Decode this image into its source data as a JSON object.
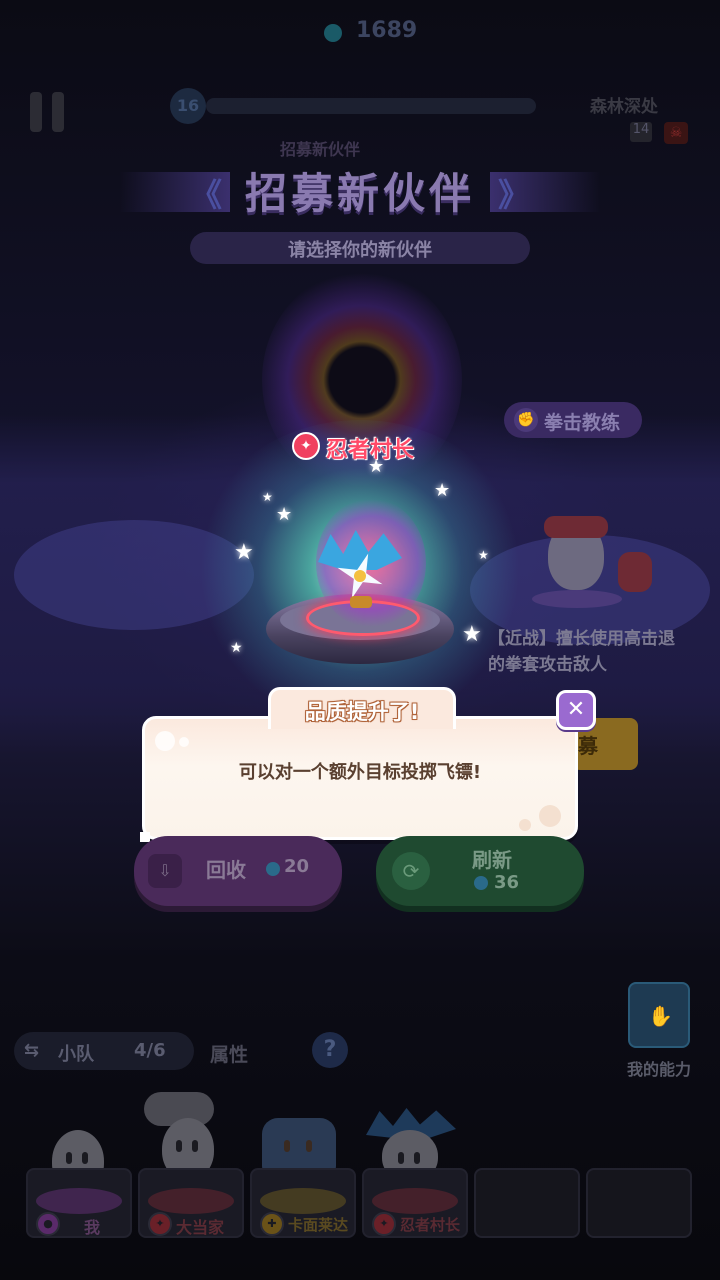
{
  "hud": {
    "gems": "1689",
    "level": "16",
    "stage_name": "森林深处",
    "wave": "14",
    "boss_icon": "skull-icon"
  },
  "header": {
    "ghost_subtitle": "招募新伙伴",
    "title": "招募新伙伴",
    "subtitle": "请选择你的新伙伴"
  },
  "featured": {
    "name": "忍者村长",
    "class_icon": "ninja-class-icon",
    "accent": "#ff4a68"
  },
  "side_candidate": {
    "name": "拳击教练",
    "desc": "【近战】擅长使用高击退的拳套攻击敌人",
    "button_label": "募"
  },
  "dialog": {
    "title": "品质提升了!",
    "message": "可以对一个额外目标投掷飞镖!",
    "close_icon": "close-icon"
  },
  "actions": {
    "recycle_label": "回收",
    "recycle_cost": "20",
    "refresh_label": "刷新",
    "refresh_cost": "36"
  },
  "team": {
    "squad_label": "小队",
    "squad_count": "4/6",
    "attributes_label": "属性",
    "help_label": "?",
    "ability_label": "我的能力",
    "members": [
      {
        "name": "我",
        "color": "#a050c0"
      },
      {
        "name": "大当家",
        "color": "#e04050"
      },
      {
        "name": "卡面莱达",
        "color": "#d0a030"
      },
      {
        "name": "忍者村长",
        "color": "#e04050"
      }
    ]
  },
  "colors": {
    "dialog_bg": "#fdf3ea",
    "close_button": "#9a6ad0",
    "refresh_button": "#1f4a30",
    "recycle_button": "#4a2a5a"
  }
}
